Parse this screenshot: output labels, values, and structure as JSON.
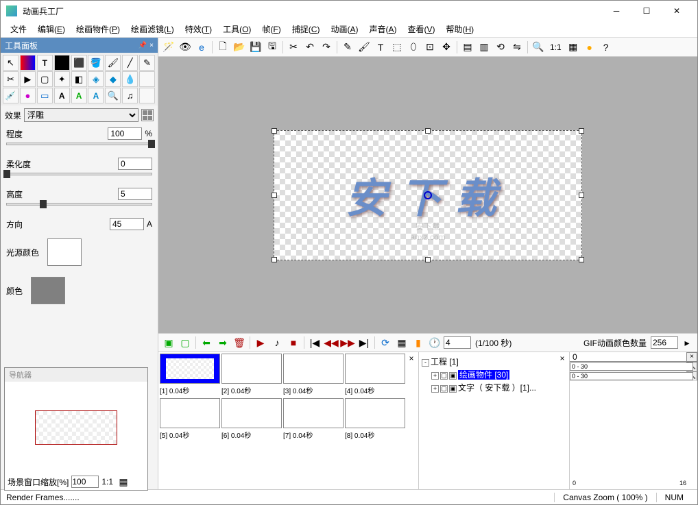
{
  "window": {
    "title": "动画兵工厂"
  },
  "menu": {
    "file": "文件",
    "edit": "编辑(E)",
    "objects": "绘画物件(P)",
    "filters": "绘画滤镜(L)",
    "effects": "特效(T)",
    "tools": "工具(O)",
    "frame": "帧(F)",
    "capture": "捕捉(C)",
    "anim": "动画(A)",
    "sound": "声音(A)",
    "view": "查看(V)",
    "help": "帮助(H)"
  },
  "toolbar": {
    "zoom_ratio": "1:1"
  },
  "tool_panel": {
    "title": "工具面板",
    "effect_label": "效果",
    "effect_selected": "浮雕",
    "degree_label": "程度",
    "degree_value": "100",
    "degree_unit": "%",
    "soft_label": "柔化度",
    "soft_value": "0",
    "height_label": "高度",
    "height_value": "5",
    "direction_label": "方向",
    "direction_value": "45",
    "direction_unit": "A",
    "light_color_label": "光源颜色",
    "light_color": "#ffffff",
    "color_label": "颜色",
    "color_value": "#808080"
  },
  "navigator": {
    "title": "导航器",
    "zoom_label": "场景窗口缩放[%]",
    "zoom_value": "100",
    "ratio": "1:1"
  },
  "canvas": {
    "text": "安下载",
    "watermark_line1": "安下载",
    "watermark_line2": "anxz.com"
  },
  "frame_toolbar": {
    "delay_value": "4",
    "delay_unit": "(1/100 秒)",
    "gif_colors_label": "GIF动画颜色数量",
    "gif_colors_value": "256"
  },
  "frames": [
    {
      "label": "[1] 0.04秒",
      "selected": true
    },
    {
      "label": "[2] 0.04秒",
      "selected": false
    },
    {
      "label": "[3] 0.04秒",
      "selected": false
    },
    {
      "label": "[4] 0.04秒",
      "selected": false
    },
    {
      "label": "[5] 0.04秒",
      "selected": false
    },
    {
      "label": "[6] 0.04秒",
      "selected": false
    },
    {
      "label": "[7] 0.04秒",
      "selected": false
    },
    {
      "label": "[8] 0.04秒",
      "selected": false
    }
  ],
  "tree": {
    "root": "工程  [1]",
    "item1": "绘画物件  [30]",
    "item2": "文字（ 安下载 ）[1]..."
  },
  "timeline": {
    "range1": "0 - 30",
    "range2": "0 - 30",
    "tick0": "0",
    "tick16": "16"
  },
  "status": {
    "left": "Render Frames.......",
    "zoom": "Canvas Zoom ( 100% )",
    "num": "NUM"
  }
}
